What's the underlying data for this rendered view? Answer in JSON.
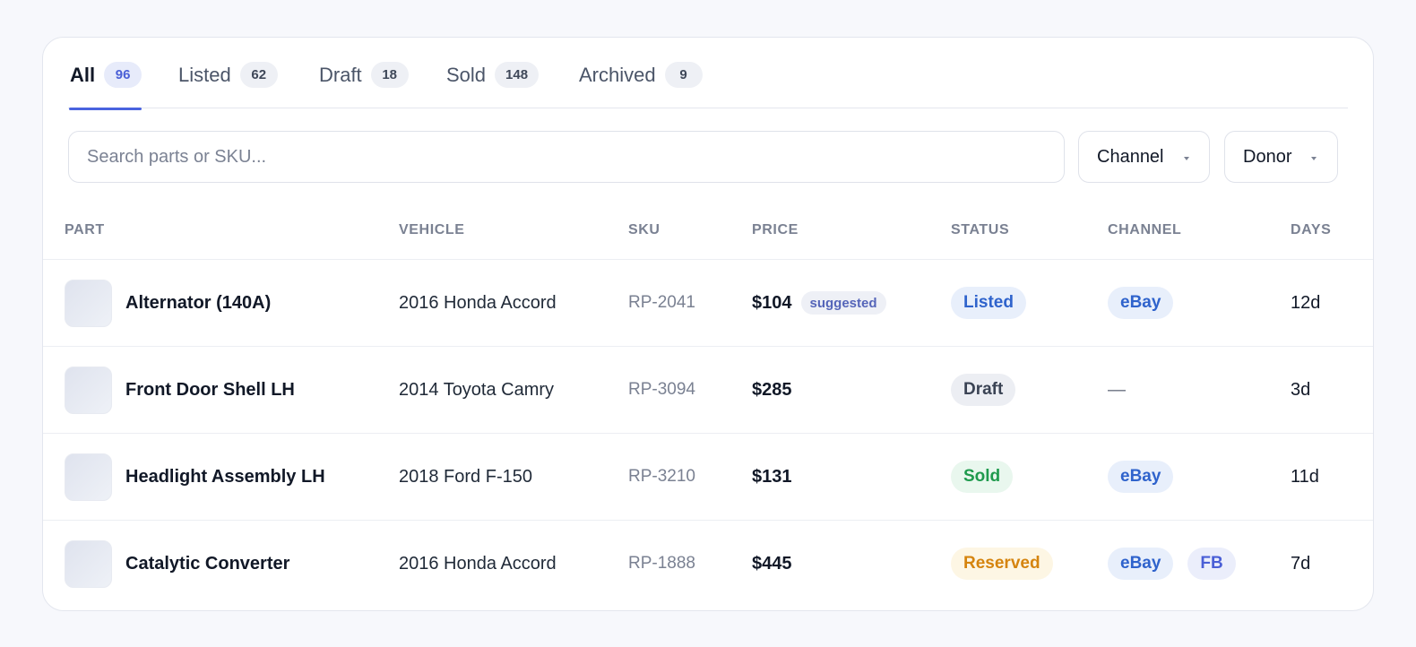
{
  "tabs": [
    {
      "label": "All",
      "count": "96",
      "active": true
    },
    {
      "label": "Listed",
      "count": "62"
    },
    {
      "label": "Draft",
      "count": "18"
    },
    {
      "label": "Sold",
      "count": "148"
    },
    {
      "label": "Archived",
      "count": "9"
    }
  ],
  "toolbar": {
    "search_placeholder": "Search parts or SKU...",
    "channel_label": "Channel",
    "donor_label": "Donor"
  },
  "table": {
    "headers": {
      "part": "PART",
      "vehicle": "VEHICLE",
      "sku": "SKU",
      "price": "PRICE",
      "status": "STATUS",
      "channel": "CHANNEL",
      "days": "DAYS"
    },
    "rows": [
      {
        "part": "Alternator (140A)",
        "vehicle": "2016 Honda Accord",
        "sku": "RP-2041",
        "price": "$104",
        "price_tag": "suggested",
        "status": "Listed",
        "channels": [
          "eBay"
        ],
        "channel_empty": "",
        "days": "12d"
      },
      {
        "part": "Front Door Shell LH",
        "vehicle": "2014 Toyota Camry",
        "sku": "RP-3094",
        "price": "$285",
        "price_tag": "",
        "status": "Draft",
        "channels": [],
        "channel_empty": "—",
        "days": "3d"
      },
      {
        "part": "Headlight Assembly LH",
        "vehicle": "2018 Ford F-150",
        "sku": "RP-3210",
        "price": "$131",
        "price_tag": "",
        "status": "Sold",
        "channels": [
          "eBay"
        ],
        "channel_empty": "",
        "days": "11d"
      },
      {
        "part": "Catalytic Converter",
        "vehicle": "2016 Honda Accord",
        "sku": "RP-1888",
        "price": "$445",
        "price_tag": "",
        "status": "Reserved",
        "channels": [
          "eBay",
          "FB"
        ],
        "channel_empty": "",
        "days": "7d"
      }
    ]
  },
  "colors": {
    "accent": "#4a63df",
    "status_listed": "#2f63cc",
    "status_draft": "#3a4354",
    "status_sold": "#1f9a4d",
    "status_reserved": "#d5840e"
  }
}
